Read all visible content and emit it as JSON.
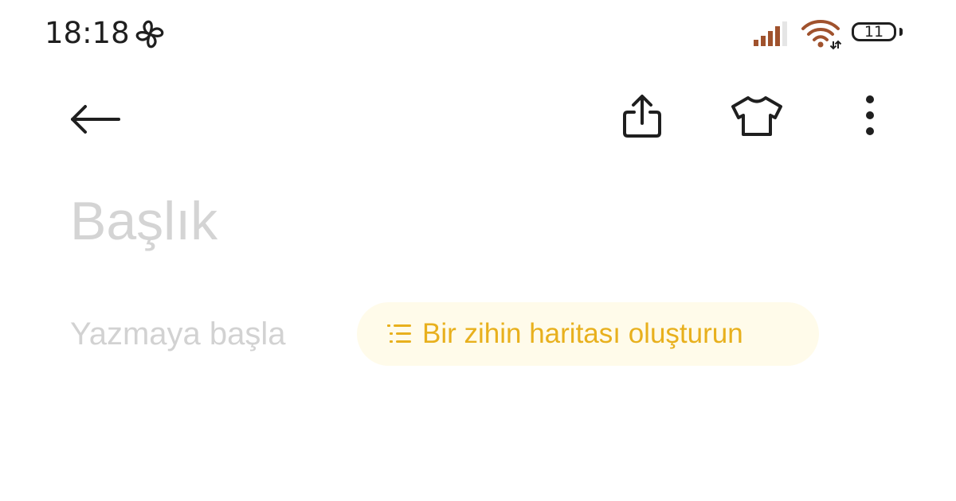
{
  "status_bar": {
    "time": "18:18",
    "battery_level": "11",
    "icons": [
      "pinwheel-icon",
      "signal-icon",
      "wifi-icon",
      "battery-icon"
    ]
  },
  "toolbar": {
    "icons": [
      "back-arrow-icon",
      "share-icon",
      "tshirt-icon",
      "more-vertical-icon"
    ]
  },
  "editor": {
    "title_placeholder": "Başlık",
    "body_placeholder": "Yazmaya başla",
    "mindmap_chip_label": "Bir zihin haritası oluşturun"
  },
  "colors": {
    "background": "#ffffff",
    "icon": "#1f1f1f",
    "placeholder": "#d4d4d4",
    "accent": "#e8b01d",
    "chip_background": "#fffbea"
  }
}
